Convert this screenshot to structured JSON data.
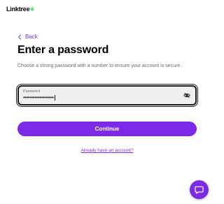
{
  "brand": {
    "name": "Linktree",
    "accent_color": "#7d2ae8",
    "logo_color": "#43e660"
  },
  "nav": {
    "back_label": "Back"
  },
  "page": {
    "title": "Enter a password",
    "subtitle": "Choose a strong password with a number to ensure your account is secure."
  },
  "password_field": {
    "label": "Password",
    "masked_value": "•••••••••••••••••••",
    "icon": "eye-off-icon"
  },
  "actions": {
    "continue_label": "Continue",
    "account_link": "Already have an account?"
  },
  "chat_widget": {
    "icon": "chat-icon"
  }
}
